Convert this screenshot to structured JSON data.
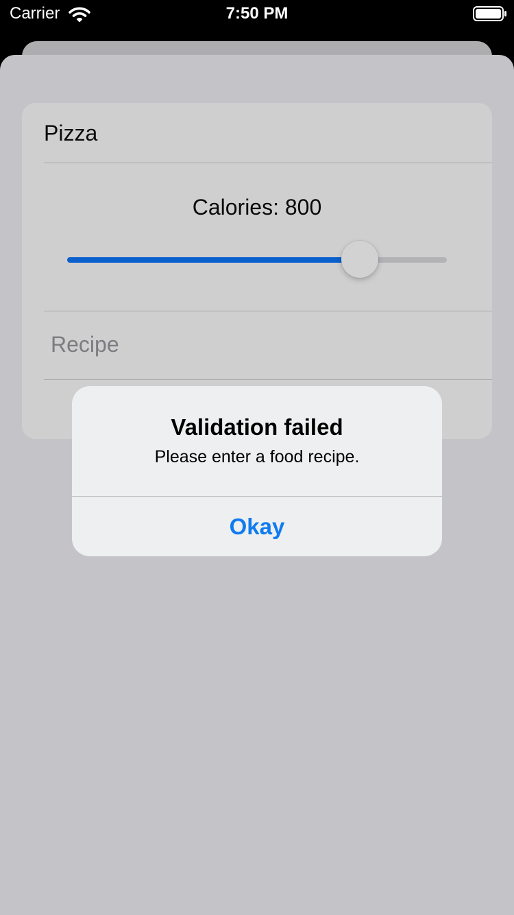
{
  "status_bar": {
    "carrier": "Carrier",
    "time": "7:50 PM",
    "icons": [
      "wifi-icon",
      "battery-icon"
    ]
  },
  "form": {
    "name_value": "Pizza",
    "calories_label": "Calories: 800",
    "calories_slider": {
      "value_fraction": 0.77,
      "accent_color": "#0a60cc"
    },
    "recipe_placeholder": "Recipe"
  },
  "alert": {
    "title": "Validation failed",
    "message": "Please enter a food recipe.",
    "button_label": "Okay",
    "button_color": "#0f7bf1"
  }
}
